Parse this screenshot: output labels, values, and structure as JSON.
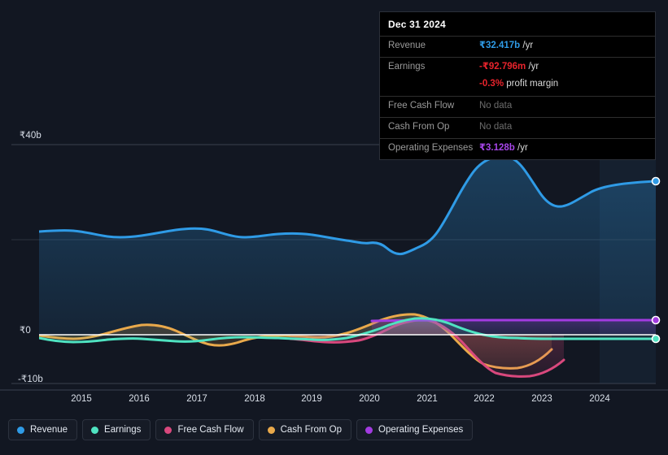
{
  "tooltip": {
    "title": "Dec 31 2024",
    "rows": [
      {
        "label": "Revenue",
        "value": "₹32.417b",
        "unit": "/yr",
        "color": "blue"
      },
      {
        "label": "Earnings",
        "value": "-₹92.796m",
        "unit": "/yr",
        "color": "red"
      },
      {
        "label": "",
        "value": "-0.3%",
        "unit": "profit margin",
        "color": "red",
        "sub": true
      },
      {
        "label": "Free Cash Flow",
        "value": "No data",
        "unit": "",
        "color": "none"
      },
      {
        "label": "Cash From Op",
        "value": "No data",
        "unit": "",
        "color": "none"
      },
      {
        "label": "Operating Expenses",
        "value": "₹3.128b",
        "unit": "/yr",
        "color": "purple"
      }
    ]
  },
  "legend": {
    "items": [
      {
        "label": "Revenue",
        "color": "#2f9be6"
      },
      {
        "label": "Earnings",
        "color": "#4fe3c1"
      },
      {
        "label": "Free Cash Flow",
        "color": "#d9487d"
      },
      {
        "label": "Cash From Op",
        "color": "#e9a94b"
      },
      {
        "label": "Operating Expenses",
        "color": "#a23be0"
      }
    ]
  },
  "axes": {
    "y_ticks": [
      {
        "label": "₹40b",
        "value": 40
      },
      {
        "label": "₹0",
        "value": 0
      },
      {
        "label": "-₹10b",
        "value": -10
      }
    ],
    "x_ticks": [
      "2015",
      "2016",
      "2017",
      "2018",
      "2019",
      "2020",
      "2021",
      "2022",
      "2023",
      "2024"
    ]
  },
  "chart_data": {
    "type": "line",
    "title": "",
    "xlabel": "",
    "ylabel": "",
    "currency": "INR",
    "unit": "billions",
    "ylim": [
      -10,
      40
    ],
    "xlim": [
      2014.2,
      2025.1
    ],
    "grid": true,
    "legend_position": "bottom-left",
    "highlight_date": "Dec 31 2024",
    "x": [
      2014.2,
      2014.5,
      2014.8,
      2015.1,
      2015.4,
      2015.7,
      2016.0,
      2016.3,
      2016.6,
      2016.9,
      2017.2,
      2017.5,
      2017.8,
      2018.1,
      2018.4,
      2018.7,
      2019.0,
      2019.3,
      2019.6,
      2019.9,
      2020.2,
      2020.5,
      2020.8,
      2021.1,
      2021.4,
      2021.7,
      2022.0,
      2022.3,
      2022.6,
      2022.9,
      2023.2,
      2023.5,
      2023.8,
      2024.1,
      2024.4,
      2024.7,
      2025.0
    ],
    "series": [
      {
        "name": "Revenue",
        "color": "#2f9be6",
        "values": [
          21.7,
          21.9,
          21.6,
          21.5,
          21.8,
          21.3,
          21.2,
          21.5,
          21.9,
          22.3,
          22.1,
          22.6,
          22.9,
          22.4,
          21.3,
          21.5,
          22.0,
          21.8,
          21.5,
          20.9,
          20.4,
          17.0,
          17.6,
          19.0,
          22.5,
          28.0,
          33.8,
          36.7,
          37.6,
          35.5,
          30.6,
          28.2,
          28.0,
          29.0,
          30.6,
          31.6,
          32.417
        ],
        "end_value": 32.417,
        "end_label": "₹32.417b /yr"
      },
      {
        "name": "Earnings",
        "color": "#4fe3c1",
        "values": [
          -0.6,
          -0.9,
          -1.1,
          -1.2,
          -1.3,
          -1.2,
          -1.1,
          -0.9,
          -0.8,
          -0.8,
          -0.9,
          -1.0,
          -1.1,
          -1.2,
          -1.1,
          -0.9,
          -0.7,
          -0.6,
          -0.6,
          -0.7,
          -0.8,
          -1.0,
          -0.9,
          -0.5,
          0.4,
          1.3,
          2.0,
          2.3,
          2.0,
          1.2,
          0.2,
          -0.3,
          -0.5,
          -0.4,
          -0.3,
          -0.2,
          -0.093
        ],
        "end_value": -0.093,
        "end_label": "-₹92.796m /yr"
      },
      {
        "name": "Free Cash Flow",
        "color": "#d9487d",
        "start_x": 2018.9,
        "values": [
          null,
          null,
          null,
          null,
          null,
          null,
          null,
          null,
          null,
          null,
          null,
          null,
          null,
          null,
          null,
          null,
          -0.9,
          -1.0,
          -1.2,
          -1.4,
          -1.5,
          -1.6,
          -1.7,
          -1.4,
          -0.7,
          0.6,
          1.6,
          2.1,
          1.6,
          -0.4,
          -3.6,
          -5.9,
          -6.7,
          -6.7,
          -6.4,
          -5.2,
          null
        ],
        "end_value": null,
        "end_label": "No data"
      },
      {
        "name": "Cash From Op",
        "color": "#e9a94b",
        "values": [
          -0.2,
          -0.4,
          -0.6,
          -0.7,
          -0.8,
          -0.8,
          -0.7,
          -0.4,
          0.2,
          0.7,
          1.0,
          1.1,
          0.8,
          0.0,
          -1.4,
          -1.9,
          -1.5,
          -0.8,
          -0.3,
          -0.1,
          -0.2,
          -0.4,
          -0.5,
          -0.2,
          0.6,
          1.8,
          2.7,
          3.1,
          2.8,
          1.5,
          -1.1,
          -3.9,
          -5.2,
          -5.3,
          -5.0,
          -3.1,
          null
        ],
        "end_value": null,
        "end_label": "No data"
      },
      {
        "name": "Operating Expenses",
        "color": "#a23be0",
        "start_x": 2019.9,
        "values": [
          null,
          null,
          null,
          null,
          null,
          null,
          null,
          null,
          null,
          null,
          null,
          null,
          null,
          null,
          null,
          null,
          null,
          null,
          null,
          2.85,
          2.9,
          2.95,
          2.95,
          2.95,
          2.95,
          3.0,
          3.0,
          3.05,
          3.05,
          3.05,
          3.05,
          3.08,
          3.1,
          3.1,
          3.11,
          3.12,
          3.128
        ],
        "end_value": 3.128,
        "end_label": "₹3.128b /yr"
      }
    ]
  }
}
